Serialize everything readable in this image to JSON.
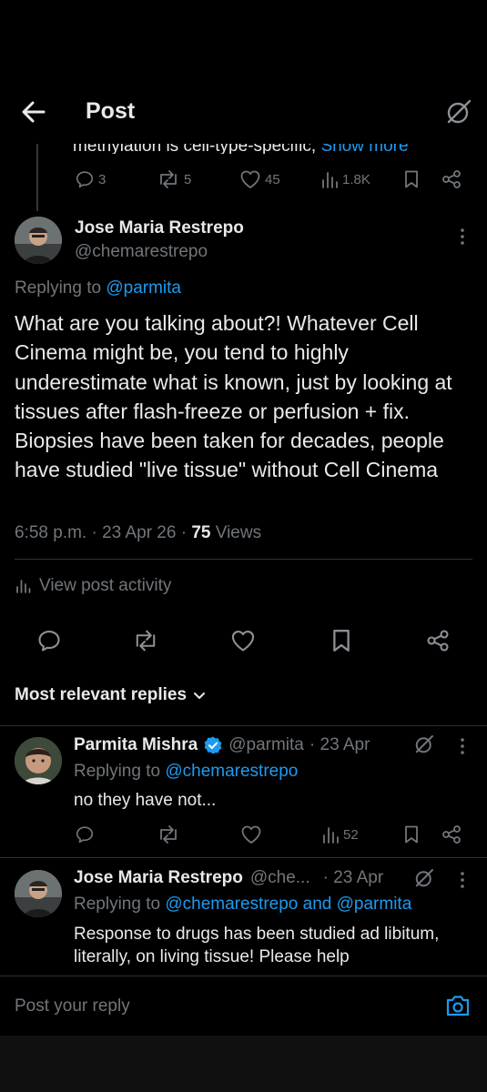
{
  "header": {
    "title": "Post"
  },
  "parent_tweet": {
    "text_tail": "methylation is cell-type-specific, ",
    "show_more": "Show more",
    "replies": "3",
    "reposts": "5",
    "likes": "45",
    "views": "1.8K"
  },
  "main_tweet": {
    "author_name": "Jose Maria Restrepo",
    "author_handle": "@chemarestrepo",
    "replying_prefix": "Replying to ",
    "replying_to": "@parmita",
    "body": "What are you talking about?! Whatever Cell Cinema might be, you tend to highly underestimate what is known, just by looking at tissues after flash-freeze or perfusion + fix. Biopsies have been taken for decades, people have studied \"live tissue\" without Cell Cinema",
    "time": "6:58 p.m. · 23 Apr 26 · ",
    "views_count": "75",
    "views_label": " Views",
    "activity_label": "View post activity"
  },
  "replies_section": {
    "label": "Most relevant replies"
  },
  "replies": [
    {
      "author_name": "Parmita Mishra",
      "author_handle": "@parmita",
      "date": "· 23 Apr",
      "replying_prefix": "Replying to ",
      "replying_to": "@chemarestrepo",
      "text": "no they have not...",
      "views": "52"
    },
    {
      "author_name": "Jose Maria Restrepo",
      "author_handle": "@che...",
      "date": "· 23 Apr",
      "replying_prefix": "Replying to ",
      "replying_to": "@chemarestrepo and @parmita",
      "text": "Response to drugs has been studied ad libitum, literally, on living tissue! Please help"
    }
  ],
  "compose": {
    "placeholder": "Post your reply"
  },
  "colors": {
    "accent": "#1d9bf0",
    "verified": "#1d9bf0",
    "muted": "#71767b",
    "background": "#000000"
  }
}
